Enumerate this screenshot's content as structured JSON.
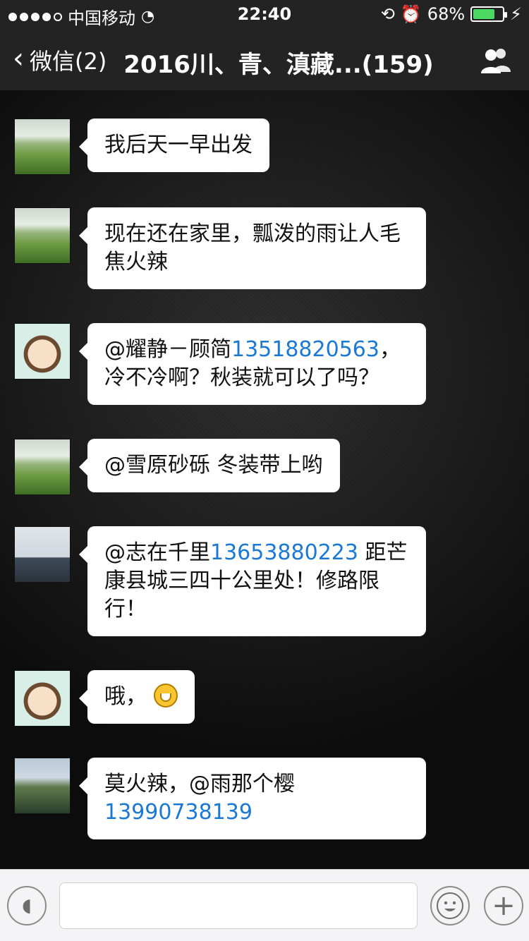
{
  "status_bar": {
    "carrier": "中国移动",
    "time": "22:40",
    "battery_percent": "68%",
    "battery_level": 0.68
  },
  "nav": {
    "back_label": "微信(2)",
    "title": "2016川、青、滇藏...(159)",
    "group_icon": "group-members-icon"
  },
  "messages": [
    {
      "avatar": "grass",
      "parts": [
        {
          "text": "我后天一早出发",
          "link": false
        }
      ]
    },
    {
      "avatar": "grass",
      "parts": [
        {
          "text": "现在还在家里，瓢泼的雨让人毛焦火辣",
          "link": false
        }
      ]
    },
    {
      "avatar": "kid",
      "parts": [
        {
          "text": "@耀静－顾简",
          "link": false
        },
        {
          "text": "13518820563",
          "link": true
        },
        {
          "text": "，冷不冷啊？秋装就可以了吗？",
          "link": false
        }
      ]
    },
    {
      "avatar": "grass",
      "parts": [
        {
          "text": "@雪原砂砾 冬装带上哟",
          "link": false
        }
      ]
    },
    {
      "avatar": "man1",
      "parts": [
        {
          "text": "@志在千里",
          "link": false
        },
        {
          "text": "13653880223",
          "link": true
        },
        {
          "text": " 距芒康县城三四十公里处！修路限行！",
          "link": false
        }
      ]
    },
    {
      "avatar": "kid",
      "parts": [
        {
          "text": "哦，",
          "link": false
        }
      ],
      "emoji": "grin-emoji-icon"
    },
    {
      "avatar": "man2",
      "parts": [
        {
          "text": "莫火辣，@雨那个樱",
          "link": false
        },
        {
          "text": "13990738139",
          "link": true
        }
      ]
    }
  ],
  "input_bar": {
    "voice_icon": "voice-icon",
    "emoji_icon": "emoji-icon",
    "plus_icon": "plus-icon",
    "input_value": "",
    "input_placeholder": ""
  },
  "colors": {
    "nav_bg": "#232323",
    "bubble_bg": "#ffffff",
    "link": "#1a78d6",
    "battery_fill": "#4cd964"
  }
}
